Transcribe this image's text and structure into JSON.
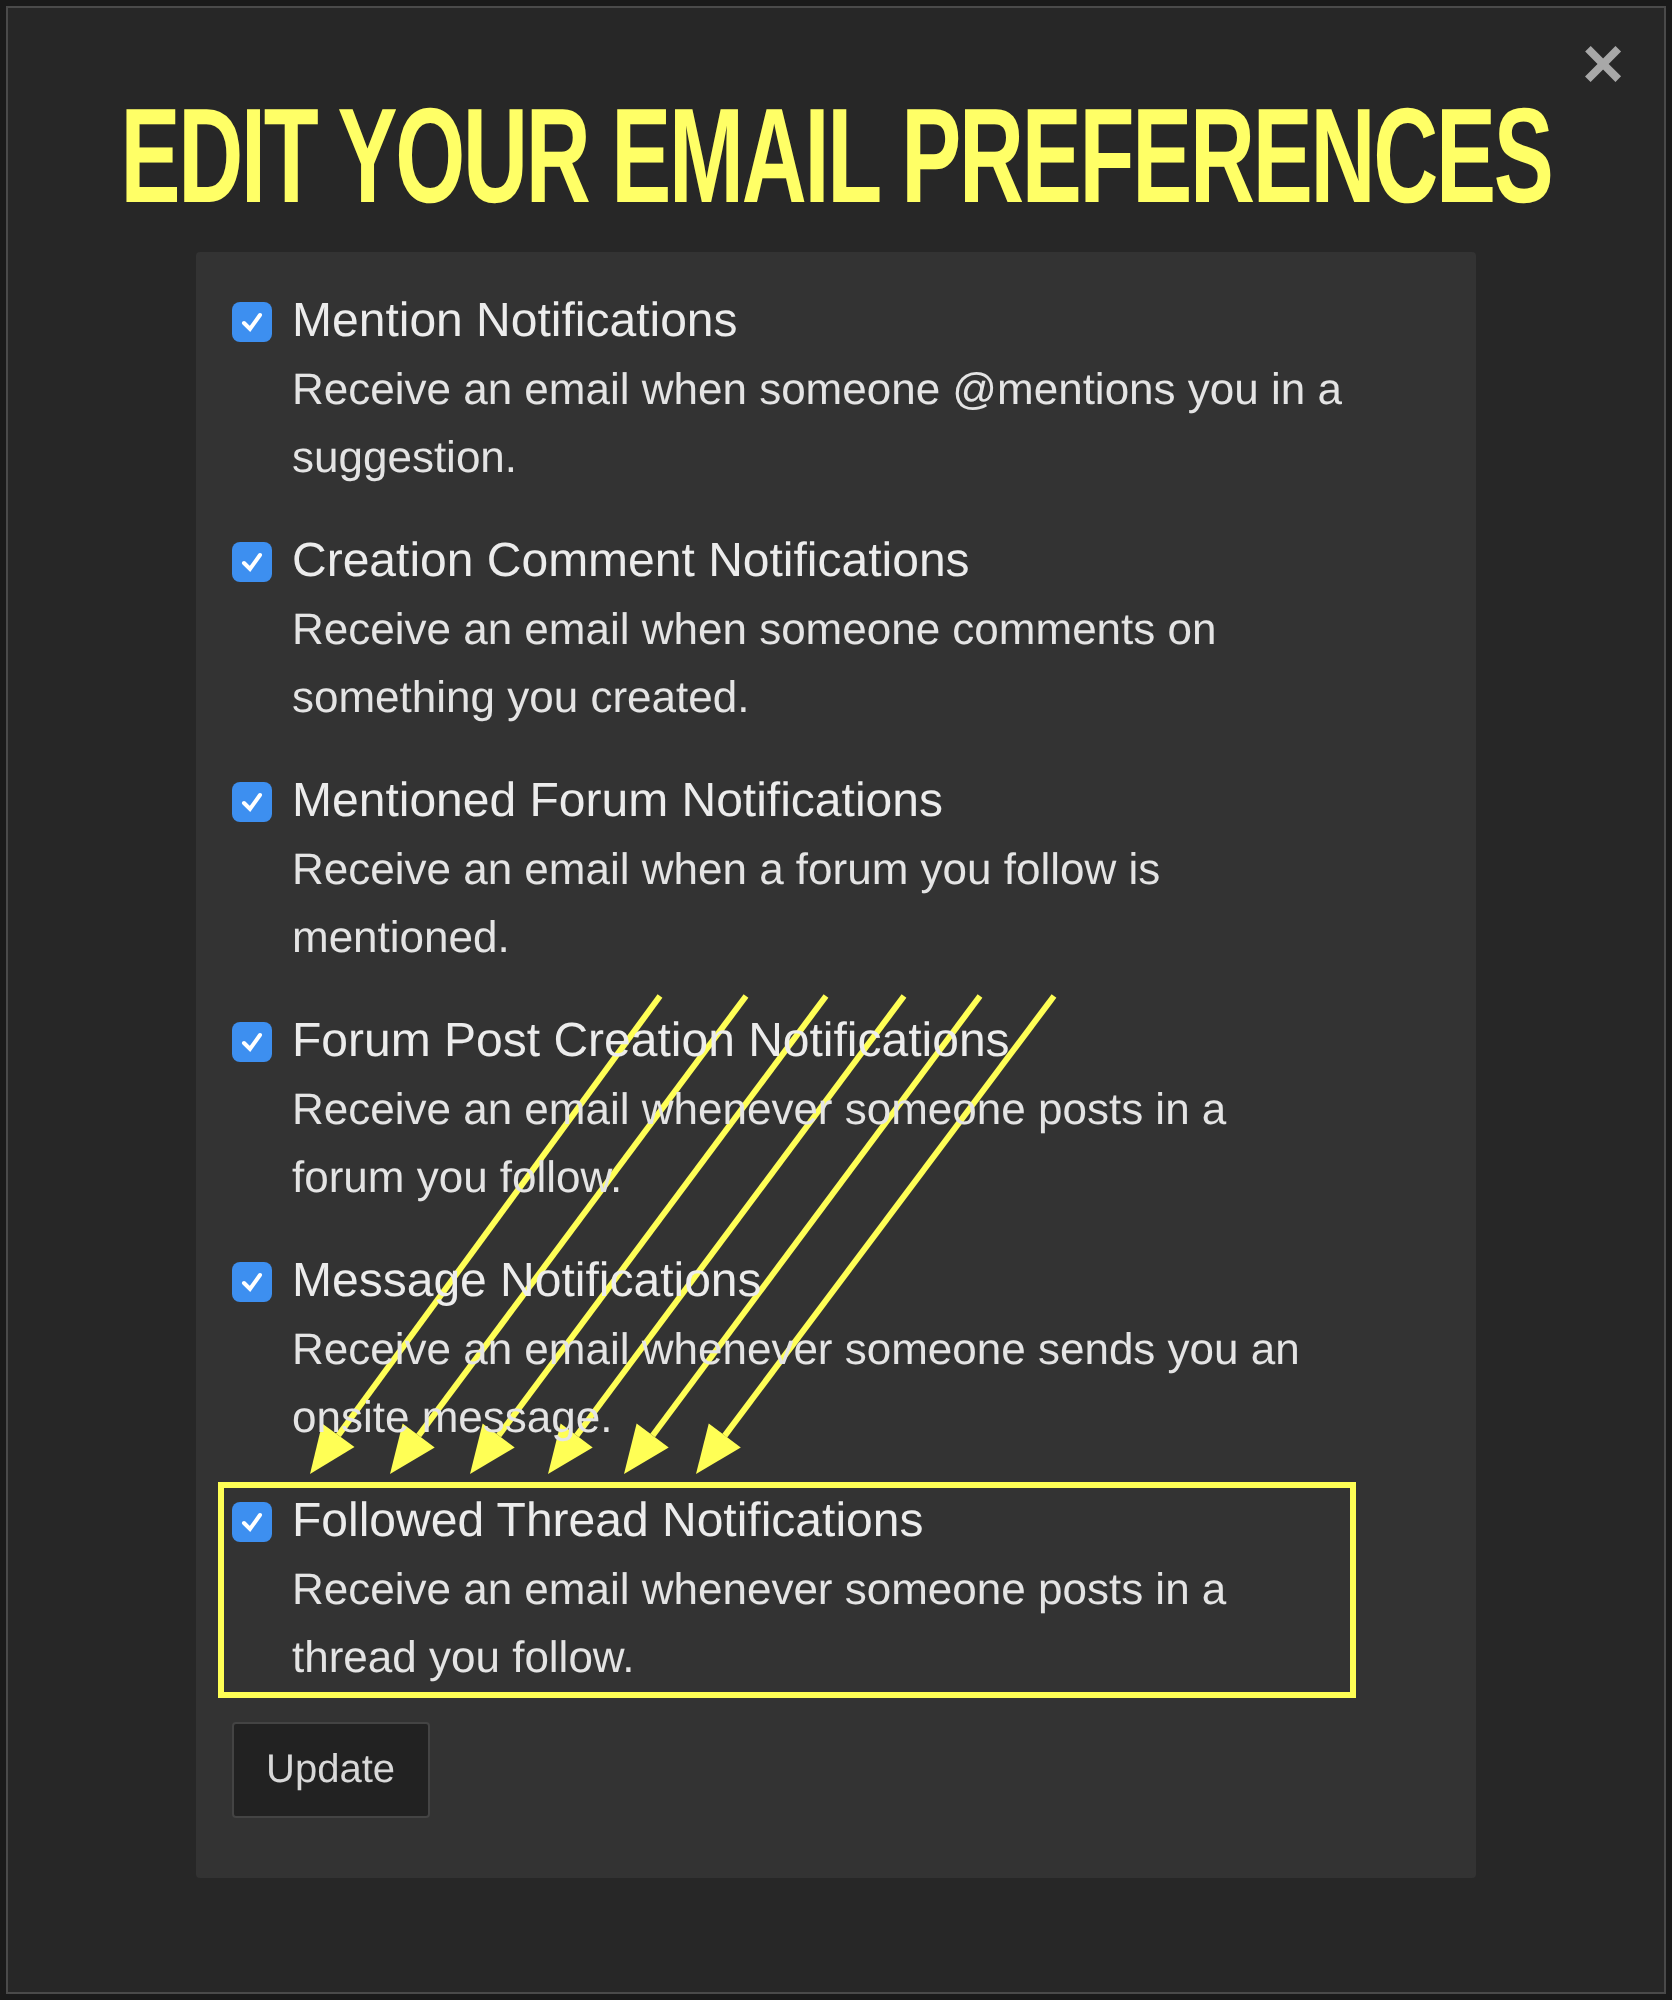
{
  "dialog": {
    "title": "EDIT YOUR EMAIL PREFERENCES",
    "close": "×"
  },
  "items": [
    {
      "title": "Mention Notifications",
      "description": "Receive an email when someone @mentions you in a suggestion.",
      "checked": true,
      "highlighted": false
    },
    {
      "title": "Creation Comment Notifications",
      "description": "Receive an email when someone comments on something you created.",
      "checked": true,
      "highlighted": false
    },
    {
      "title": "Mentioned Forum Notifications",
      "description": "Receive an email when a forum you follow is mentioned.",
      "checked": true,
      "highlighted": false
    },
    {
      "title": "Forum Post Creation Notifications",
      "description": "Receive an email whenever someone posts in a forum you follow.",
      "checked": true,
      "highlighted": false
    },
    {
      "title": "Message Notifications",
      "description": "Receive an email whenever someone sends you an onsite message.",
      "checked": true,
      "highlighted": false
    },
    {
      "title": "Followed Thread Notifications",
      "description": "Receive an email whenever someone posts in a thread you follow.",
      "checked": true,
      "highlighted": true
    }
  ],
  "buttons": [
    "Update"
  ]
}
